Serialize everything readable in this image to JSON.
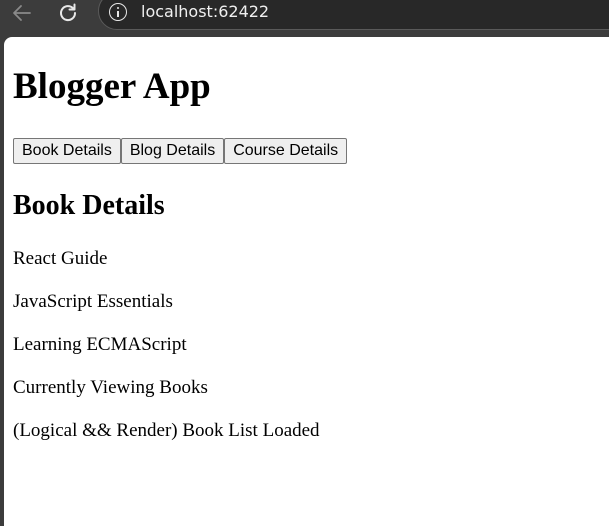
{
  "browser": {
    "url": "localhost:62422",
    "icons": {
      "back": "arrow-left-icon",
      "reload": "reload-icon",
      "info": "info-icon"
    }
  },
  "app": {
    "title": "Blogger App",
    "buttons": [
      {
        "label": "Book Details"
      },
      {
        "label": "Blog Details"
      },
      {
        "label": "Course Details"
      }
    ],
    "section": {
      "heading": "Book Details",
      "items": [
        "React Guide",
        "JavaScript Essentials",
        "Learning ECMAScript"
      ],
      "status": "Currently Viewing Books",
      "logical_render": "(Logical && Render) Book List Loaded"
    }
  }
}
